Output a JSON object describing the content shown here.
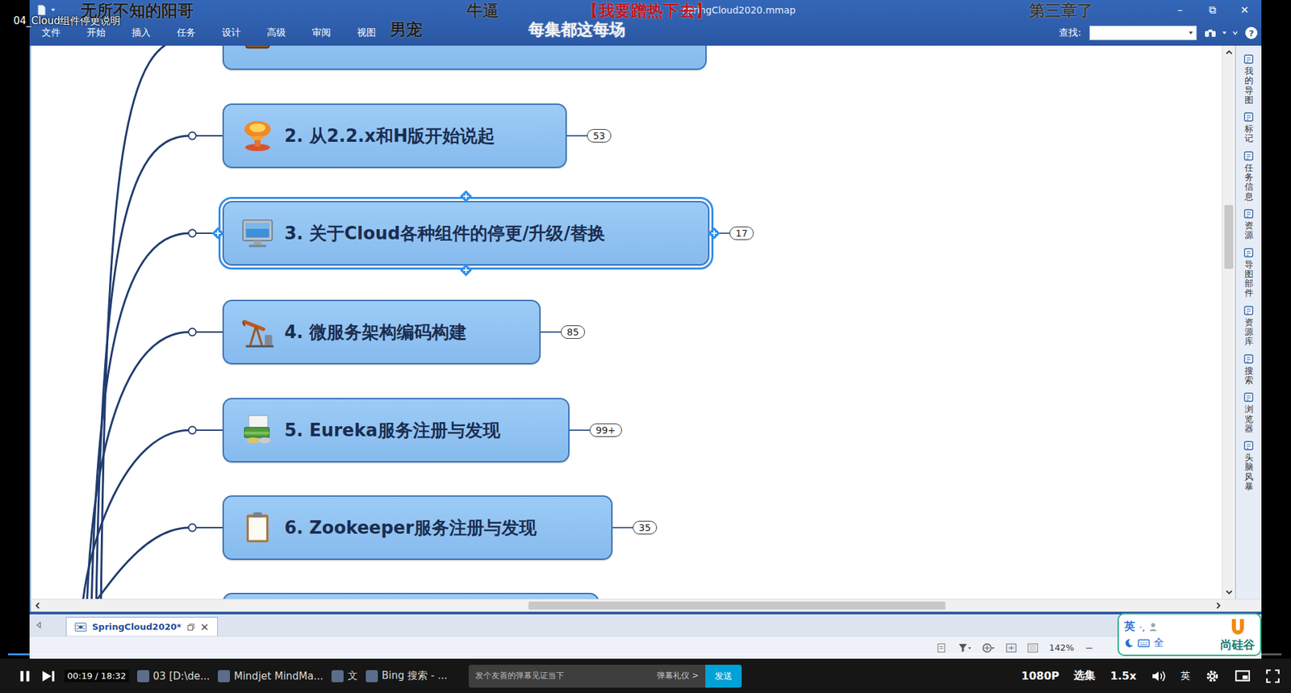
{
  "video": {
    "title": "04_Cloud组件停更说明"
  },
  "window": {
    "title": "springCloud2020.mmap",
    "controls": [
      "–",
      "⧉",
      "✕"
    ]
  },
  "menu": [
    "文件",
    "开始",
    "插入",
    "任务",
    "设计",
    "高级",
    "审阅",
    "视图"
  ],
  "search": {
    "label": "查找:"
  },
  "help": "?",
  "danmaku": [
    {
      "text": "无所不知的阳哥",
      "color": "#1c1c1c"
    },
    {
      "text": "牛逼",
      "color": "#2a2a2a"
    },
    {
      "text": "【我要蹭热下去】",
      "color": "#c0141c"
    },
    {
      "text": "男宠",
      "color": "#1c1c1c"
    },
    {
      "text": "每集都这每场",
      "color": "#f2f2f2"
    },
    {
      "text": "第三章了",
      "color": "#3a3a3a"
    }
  ],
  "mindmap": {
    "nodes": [
      {
        "kind": "cut",
        "selected": false
      },
      {
        "kind": "topic",
        "label": "2. 从2.2.x和H版开始说起",
        "count": "53",
        "selected": false
      },
      {
        "kind": "topic",
        "label": "3. 关于Cloud各种组件的停更/升级/替换",
        "count": "17",
        "selected": true
      },
      {
        "kind": "topic",
        "label": "4. 微服务架构编码构建",
        "count": "85",
        "selected": false
      },
      {
        "kind": "topic",
        "label": "5. Eureka服务注册与发现",
        "count": "99+",
        "selected": false
      },
      {
        "kind": "topic",
        "label": "6. Zookeeper服务注册与发现",
        "count": "35",
        "selected": false
      },
      {
        "kind": "cut",
        "selected": false
      }
    ]
  },
  "sidebar": {
    "panels": [
      "我的导图",
      "标记",
      "任务信息",
      "资源",
      "导图部件",
      "资源库",
      "搜索",
      "浏览器",
      "头脑风暴"
    ]
  },
  "scrollbars": {
    "vertical": {
      "thumb_start": 0.28,
      "thumb_size": 0.12
    },
    "horizontal": {
      "thumb_start": 0.415,
      "thumb_size": 0.357
    }
  },
  "tab": {
    "label": "SpringCloud2020*",
    "selected": true,
    "close": "×"
  },
  "status": {
    "zoom": "142%",
    "zoom_out": "−"
  },
  "overlay": {
    "ime_lang": "英",
    "ime_punct": "·,",
    "ime_width": "全",
    "logo": "尚硅谷"
  },
  "player": {
    "playing": true,
    "progress": 0.017,
    "time": "00:19 / 18:32",
    "taskbar": [
      "03 [D:\\de...",
      "Mindjet MindMa...",
      "文",
      "Bing 搜索 - ..."
    ],
    "danmaku_placeholder": "发个友善的弹幕见证当下",
    "etiquette": "弹幕礼仪 >",
    "send": "发送",
    "quality": "1080P",
    "episodes": "选集",
    "speed": "1.5x",
    "lang": "英"
  }
}
